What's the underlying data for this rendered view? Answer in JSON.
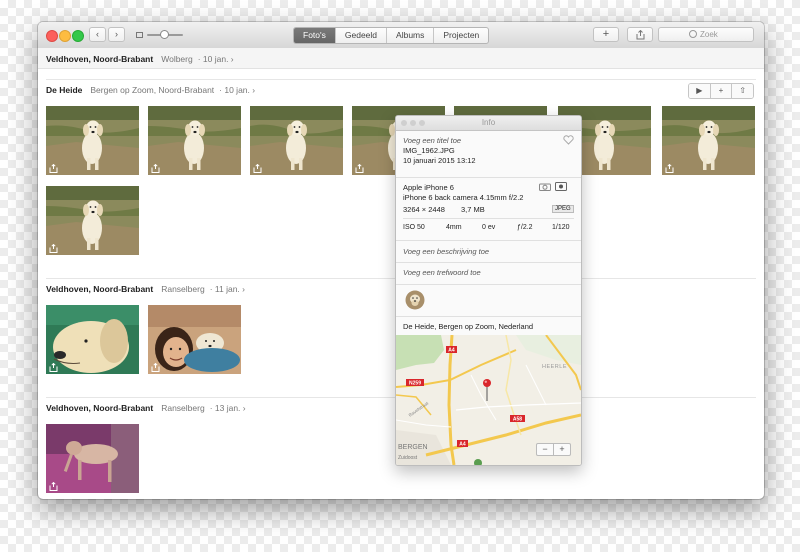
{
  "toolbar": {
    "tabs": [
      {
        "label": "Foto's",
        "active": true
      },
      {
        "label": "Gedeeld",
        "active": false
      },
      {
        "label": "Albums",
        "active": false
      },
      {
        "label": "Projecten",
        "active": false
      }
    ],
    "add_label": "+",
    "search_placeholder": "Zoek",
    "zoom_fraction": 0.45
  },
  "moments": [
    {
      "title": "Veldhoven, Noord-Brabant",
      "location": "Wolberg",
      "date": "· 10 jan. ›"
    },
    {
      "title": "De Heide",
      "location": "Bergen op Zoom, Noord-Brabant",
      "date": "· 10 jan. ›"
    },
    {
      "title": "Veldhoven, Noord-Brabant",
      "location": "Ranselberg",
      "date": "· 11 jan. ›"
    },
    {
      "title": "Veldhoven, Noord-Brabant",
      "location": "Ranselberg",
      "date": "· 13 jan. ›"
    }
  ],
  "moment_actions": [
    "▶",
    "+",
    "⇧"
  ],
  "info_panel": {
    "title": "Info",
    "add_title": "Voeg een titel toe",
    "filename": "IMG_1962.JPG",
    "datetime": "10 januari 2015   13:12",
    "camera": "Apple iPhone 6",
    "lens": "iPhone 6 back camera 4.15mm f/2.2",
    "dimensions": "3264 × 2448",
    "size": "3,7 MB",
    "format": "JPEG",
    "iso": "ISO 50",
    "focal": "4mm",
    "ev": "0 ev",
    "aperture": "ƒ/2.2",
    "shutter": "1/120",
    "add_description": "Voeg een beschrijving toe",
    "add_keyword": "Voeg een trefwoord toe",
    "location": "De Heide, Bergen op Zoom, Nederland",
    "map": {
      "labels": {
        "road_a4_top": "A4",
        "road_n259": "N259",
        "road_a58": "A58",
        "road_a4_bottom": "A4",
        "heerle": "HEERLE",
        "bergen": "BERGEN",
        "zuidoost": "Zuidoost",
        "ravelstraat": "Ravelstraat"
      },
      "zoom_out": "−",
      "zoom_in": "+"
    }
  },
  "colors": {
    "accent_tab": "#6f6f6f",
    "map_road": "#f3c84e",
    "pin": "#d9262b"
  }
}
